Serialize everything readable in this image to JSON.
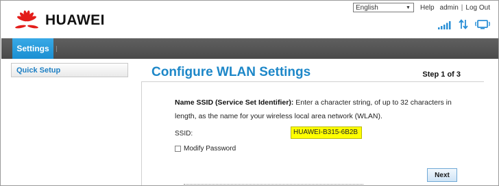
{
  "header": {
    "brand": "HUAWEI",
    "language": "English",
    "links": {
      "help": "Help",
      "user": "admin",
      "logout": "Log Out"
    },
    "status_icons": [
      "signal-strength-icon",
      "data-transfer-icon",
      "wifi-monitor-icon"
    ]
  },
  "nav": {
    "settings": "Settings"
  },
  "sidebar": {
    "items": [
      {
        "label": "Quick Setup"
      }
    ]
  },
  "main": {
    "title": "Configure WLAN Settings",
    "step": "Step 1 of 3",
    "desc_bold": "Name SSID (Service Set Identifier):",
    "desc_text": " Enter a character string, of up to 32 characters in length, as the name for your wireless local area network (WLAN).",
    "ssid_label": "SSID:",
    "ssid_value": "HUAWEI-B315-6B2B",
    "modify_password": "Modify Password",
    "next": "Next"
  },
  "colors": {
    "accent": "#1d87c8",
    "nav_bar": "#555555",
    "nav_tab": "#2a9de0",
    "logo_red": "#e31d1a",
    "ssid_highlight": "#ffff00"
  }
}
